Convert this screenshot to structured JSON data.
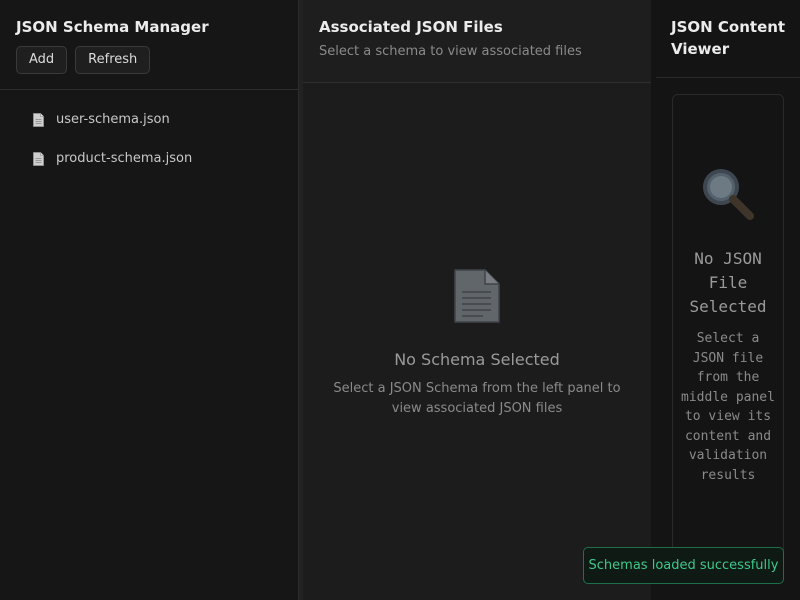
{
  "left_panel": {
    "title": "JSON Schema Manager",
    "add_label": "Add",
    "refresh_label": "Refresh",
    "files": [
      {
        "name": "user-schema.json",
        "icon": "document-icon"
      },
      {
        "name": "product-schema.json",
        "icon": "document-icon"
      }
    ]
  },
  "middle_panel": {
    "title": "Associated JSON Files",
    "subtitle": "Select a schema to view associated files",
    "empty_icon": "document-icon",
    "empty_title": "No Schema Selected",
    "empty_description": "Select a JSON Schema from the left panel to view associated JSON files"
  },
  "right_panel": {
    "title": "JSON Content Viewer",
    "empty_icon": "magnifier-icon",
    "empty_title": "No JSON File Selected",
    "empty_description": "Select a JSON file from the middle panel to view its content and validation results"
  },
  "toast": {
    "message": "Schemas loaded successfully",
    "color": "#3ec88a"
  }
}
